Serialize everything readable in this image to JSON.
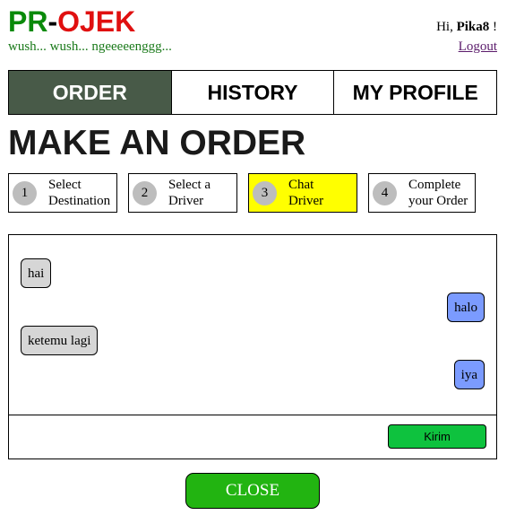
{
  "header": {
    "logo_pr": "PR",
    "logo_dash": "-",
    "logo_ojek": "OJEK",
    "tagline": "wush... wush... ngeeeeenggg...",
    "greeting_prefix": "Hi, ",
    "username": "Pika8",
    "greeting_suffix": " !",
    "logout": "Logout"
  },
  "nav": {
    "tabs": [
      {
        "label": "ORDER",
        "active": true
      },
      {
        "label": "HISTORY",
        "active": false
      },
      {
        "label": "MY PROFILE",
        "active": false
      }
    ]
  },
  "page_title": "MAKE AN ORDER",
  "steps": [
    {
      "number": "1",
      "label": "Select\nDestination",
      "active": false
    },
    {
      "number": "2",
      "label": "Select a\nDriver",
      "active": false
    },
    {
      "number": "3",
      "label": "Chat\nDriver",
      "active": true
    },
    {
      "number": "4",
      "label": "Complete\nyour Order",
      "active": false
    }
  ],
  "chat": {
    "messages": [
      {
        "text": "hai",
        "side": "left"
      },
      {
        "text": "halo",
        "side": "right"
      },
      {
        "text": "ketemu lagi",
        "side": "left"
      },
      {
        "text": "iya",
        "side": "right"
      }
    ],
    "send_label": "Kirim"
  },
  "close_label": "CLOSE",
  "colors": {
    "active_tab": "#485a48",
    "active_step": "#ffff00",
    "bubble_left": "#d6d6d6",
    "bubble_right": "#7b9bff",
    "send_button": "#0ec23e",
    "close_button": "#22b411"
  }
}
